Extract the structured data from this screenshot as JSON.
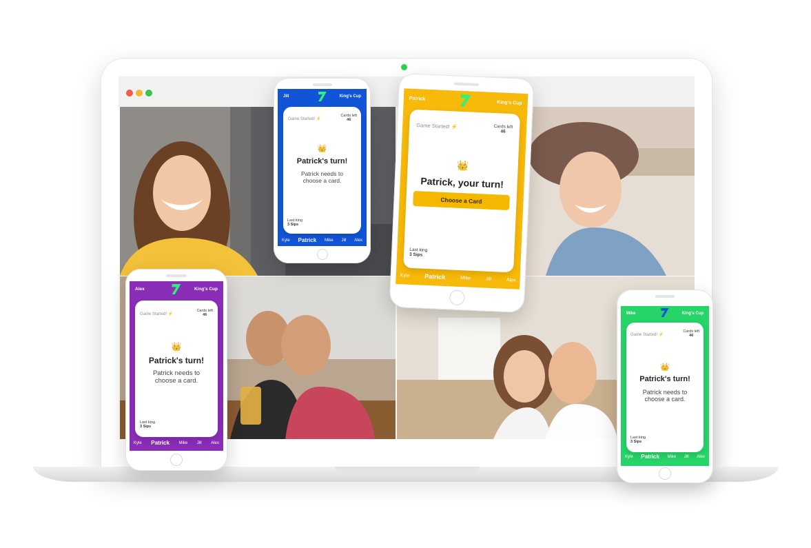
{
  "browser": {
    "dot_colors": [
      "#f25a4b",
      "#f7b733",
      "#3cc34a"
    ]
  },
  "tabs_colors": {
    "jill": "#1254d8",
    "patrick": "#f7b90a",
    "alex": "#8a2db7",
    "mike": "#27d468"
  },
  "phones": {
    "jill": {
      "user": "Jill",
      "game": "King's Cup",
      "status": "Game Started! ⚡",
      "cards_left_label": "Cards left",
      "cards_left": "46",
      "turn": "Patrick's turn!",
      "message": "Patrick needs to choose a card.",
      "last_king_label": "Last king",
      "last_king": "3 Sips",
      "players": [
        "Kyle",
        "Patrick",
        "Mike",
        "Jill",
        "Alex"
      ]
    },
    "patrick": {
      "user": "Patrick",
      "game": "King's Cup",
      "status": "Game Started! ⚡",
      "cards_left_label": "Cards left",
      "cards_left": "46",
      "turn": "Patrick, your turn!",
      "button": "Choose a Card",
      "last_king_label": "Last king",
      "last_king": "3 Sips",
      "players": [
        "Kyle",
        "Patrick",
        "Mike",
        "Jill",
        "Alex"
      ]
    },
    "alex": {
      "user": "Alex",
      "game": "King's Cup",
      "status": "Game Started! ⚡",
      "cards_left_label": "Cards left",
      "cards_left": "46",
      "turn": "Patrick's turn!",
      "message": "Patrick needs to choose a card.",
      "last_king_label": "Last king",
      "last_king": "3 Sips",
      "players": [
        "Kyle",
        "Patrick",
        "Mike",
        "Jill",
        "Alex"
      ]
    },
    "mike": {
      "user": "Mike",
      "game": "King's Cup",
      "status": "Game Started! ⚡",
      "cards_left_label": "Cards left",
      "cards_left": "46",
      "turn": "Patrick's turn!",
      "message": "Patrick needs to choose a card.",
      "last_king_label": "Last king",
      "last_king": "3 Sips",
      "players": [
        "Kyle",
        "Patrick",
        "Mike",
        "Jill",
        "Alex"
      ]
    }
  }
}
